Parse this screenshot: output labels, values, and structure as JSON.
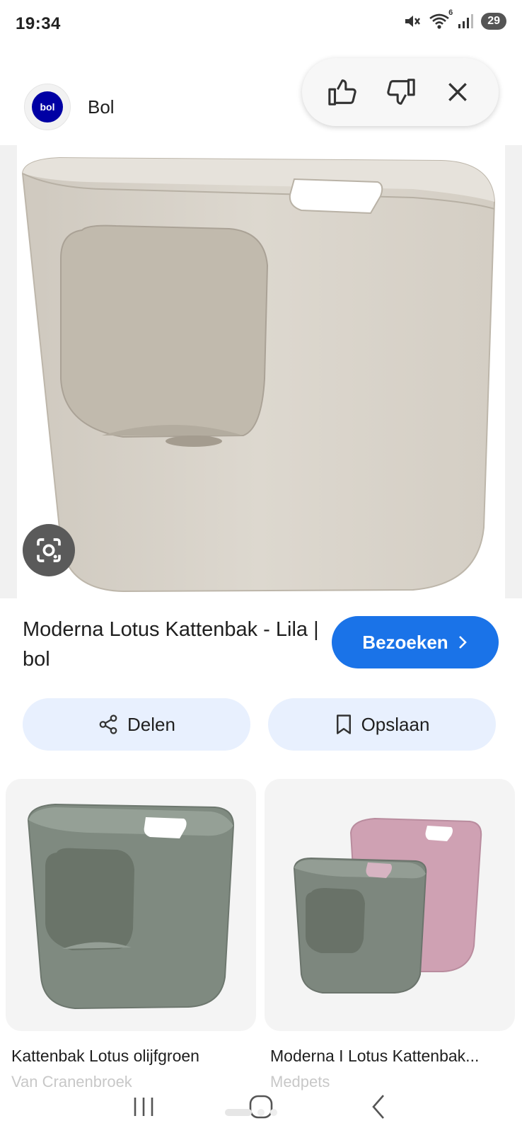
{
  "status_bar": {
    "time": "19:34",
    "wifi_badge": "6",
    "battery": "29"
  },
  "source": {
    "logo_text": "bol",
    "name": "Bol"
  },
  "feedback": {
    "thumbs_up_icon": "thumbs-up-icon",
    "thumbs_down_icon": "thumbs-down-icon",
    "close_icon": "close-icon"
  },
  "main_image": {
    "lens_icon": "lens-icon"
  },
  "result": {
    "title": "Moderna Lotus Kattenbak - Lila | bol",
    "visit_label": "Bezoeken"
  },
  "actions": {
    "share_label": "Delen",
    "save_label": "Opslaan"
  },
  "related": [
    {
      "title": "Kattenbak Lotus olijfgroen",
      "source": "Van Cranenbroek"
    },
    {
      "title": "Moderna I Lotus Kattenbak...",
      "source": "Medpets"
    }
  ],
  "colors": {
    "accent": "#1a73e8",
    "action_bg": "#e8f0fe",
    "bol_blue": "#0000a4"
  }
}
